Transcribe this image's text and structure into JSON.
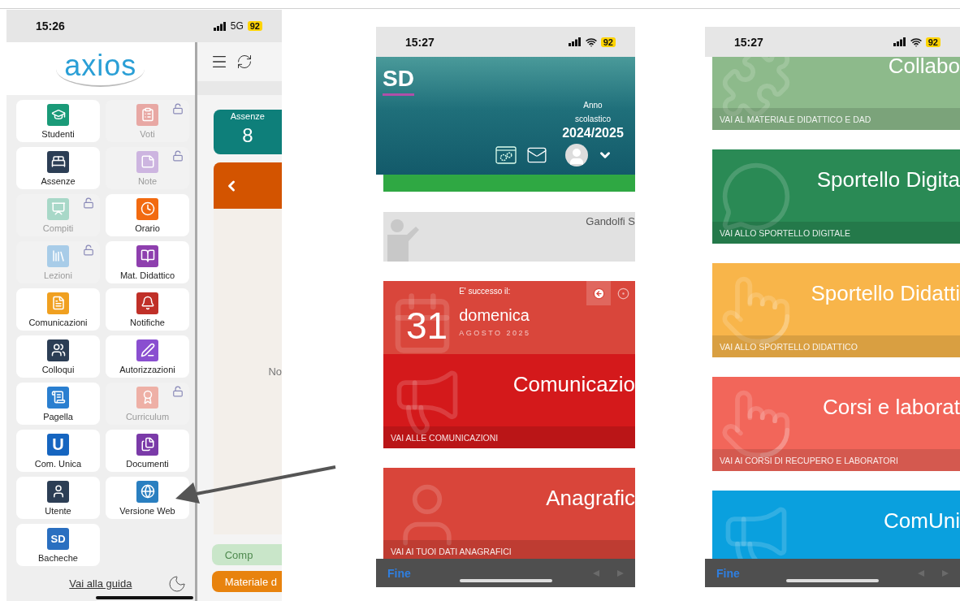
{
  "menu_phone": {
    "status": {
      "time": "15:26",
      "network": "5G",
      "battery": "92"
    },
    "logo": "axios",
    "tiles": [
      {
        "label": "Studenti",
        "locked": false,
        "color": "#1a9a78"
      },
      {
        "label": "Voti",
        "locked": true,
        "color": "#e8a8a4"
      },
      {
        "label": "Assenze",
        "locked": false,
        "color": "#2c3e55"
      },
      {
        "label": "Note",
        "locked": true,
        "color": "#cdb5e0"
      },
      {
        "label": "Compiti",
        "locked": true,
        "color": "#a8d8c8"
      },
      {
        "label": "Orario",
        "locked": false,
        "color": "#f26a10"
      },
      {
        "label": "Lezioni",
        "locked": true,
        "color": "#a8cce8"
      },
      {
        "label": "Mat. Didattico",
        "locked": false,
        "color": "#8e3fae"
      },
      {
        "label": "Comunicazioni",
        "locked": false,
        "color": "#f0a020"
      },
      {
        "label": "Notifiche",
        "locked": false,
        "color": "#c03028"
      },
      {
        "label": "Colloqui",
        "locked": false,
        "color": "#2c3e55"
      },
      {
        "label": "Autorizzazioni",
        "locked": false,
        "color": "#8a4fd0"
      },
      {
        "label": "Pagella",
        "locked": false,
        "color": "#2a7fd0"
      },
      {
        "label": "Curriculum",
        "locked": true,
        "color": "#eeb0a6"
      },
      {
        "label": "Com. Unica",
        "locked": false,
        "color": "#1565c0",
        "glyph": "U"
      },
      {
        "label": "Documenti",
        "locked": false,
        "color": "#7a3aa8"
      },
      {
        "label": "Utente",
        "locked": false,
        "color": "#2c3e55"
      },
      {
        "label": "Versione Web",
        "locked": false,
        "color": "#2a7fc0"
      },
      {
        "label": "Bacheche",
        "locked": false,
        "color": "#2a6fc0",
        "glyph": "SD"
      }
    ],
    "guide_link": "Vai alla guida",
    "content": {
      "stat_label": "Assenze",
      "stat_value": "8",
      "note": "No",
      "buttons": [
        {
          "label": "Comp",
          "kind": "faded"
        },
        {
          "label": "Materiale d",
          "kind": "solid"
        }
      ]
    }
  },
  "home_phone": {
    "status": {
      "time": "15:27",
      "battery": "92"
    },
    "header": {
      "logo": "SD",
      "year_label": "Anno scolastico",
      "year": "2024/2025"
    },
    "user_name": "Gandolfi S",
    "event": {
      "caption": "E' successo il:",
      "day": "31",
      "weekday": "domenica",
      "month": "AGOSTO 2025"
    },
    "tiles": [
      {
        "title": "Comunicazio",
        "link": "VAI ALLE COMUNICAZIONI",
        "color": "#d4191b"
      },
      {
        "title": "Anagrafic",
        "link": "VAI AI TUOI DATI ANAGRAFICI",
        "color": "#d9453a"
      }
    ],
    "keyboard_done": "Fine"
  },
  "tiles_phone": {
    "status": {
      "time": "15:27",
      "battery": "92"
    },
    "tiles": [
      {
        "title": "Collabo",
        "link": "VAI AL MATERIALE DIDATTICO E DAD",
        "color": "#8dba8b"
      },
      {
        "title": "Sportello Digita",
        "link": "VAI ALLO SPORTELLO DIGITALE",
        "color": "#2a8a55"
      },
      {
        "title": "Sportello Didatti",
        "link": "VAI ALLO SPORTELLO DIDATTICO",
        "color": "#f8b54a"
      },
      {
        "title": "Corsi e laborat",
        "link": "VAI AI CORSI DI RECUPERO E LABORATORI",
        "color": "#f2665a"
      },
      {
        "title": "ComUni",
        "color": "#0aa0de"
      }
    ],
    "keyboard_done": "Fine"
  }
}
